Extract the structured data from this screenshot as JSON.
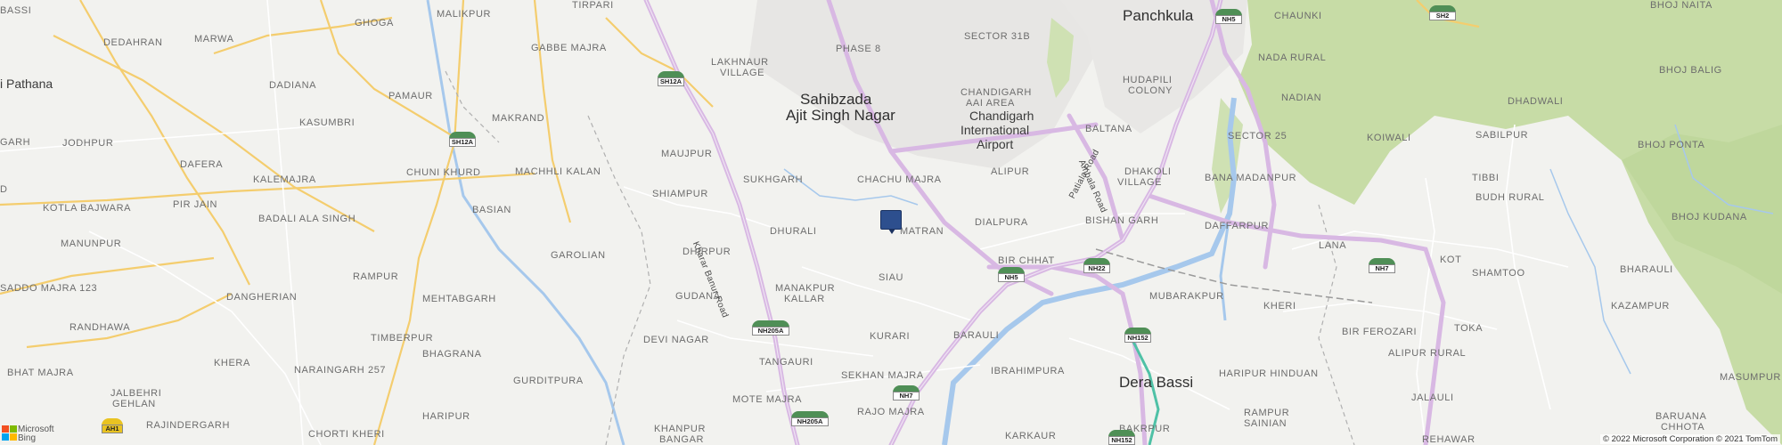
{
  "map": {
    "places": {
      "panchkula": "Panchkula",
      "sahibzada": "Sahibzada\nAjit Singh Nagar",
      "sahibzada_1": "Sahibzada",
      "sahibzada_2": "Ajit Singh Nagar",
      "dera_bassi": "Dera Bassi",
      "chandigarh_airport_1": "Chandigarh",
      "chandigarh_airport_2": "International",
      "chandigarh_airport_3": "Airport",
      "pathana": "i Pathana",
      "basi": "BASSI",
      "ghoga": "GHOGA",
      "malikpur": "MALIKPUR",
      "tirpari": "TIRPARI",
      "dedahran": "DEDAHRAN",
      "marwa": "MARWA",
      "gabbe_majra": "GABBE MAJRA",
      "lakhnaur_1": "LAKHNAUR",
      "lakhnaur_2": "VILLAGE",
      "phase8": "PHASE 8",
      "sector31b": "SECTOR 31B",
      "chaunki": "CHAUNKI",
      "bhoj_naita": "BHOJ NAITA",
      "nada_rural": "NADA RURAL",
      "hudapili_1": "HUDAPILI",
      "hudapili_2": "COLONY",
      "chandigarh_aai_1": "CHANDIGARH",
      "chandigarh_aai_2": "AAI AREA",
      "bhoj_balig": "BHOJ BALIG",
      "dadiana": "DADIANA",
      "pamaur": "PAMAUR",
      "nadian": "NADIAN",
      "dhadwali": "DHADWALI",
      "garh": "GARH",
      "kasumbri": "KASUMBRI",
      "makrand": "MAKRAND",
      "baltana": "BALTANA",
      "sector25": "SECTOR 25",
      "sabilpur": "SABILPUR",
      "koiwali": "KOIWALI",
      "bhoj_ponta": "BHOJ PONTA",
      "jodhpur": "JODHPUR",
      "maujpur": "MAUJPUR",
      "alipur": "ALIPUR",
      "dhakoli_1": "DHAKOLI",
      "dhakoli_2": "VILLAGE",
      "bana_madanpur": "BANA MADANPUR",
      "tibbi": "TIBBI",
      "dafera": "DAFERA",
      "chuni_khurd": "CHUNI KHURD",
      "machhli_kalan": "MACHHLI KALAN",
      "sukhgarh": "SUKHGARH",
      "chachu_majra": "CHACHU MAJRA",
      "kalemajra": "KALEMAJRA",
      "d": "D",
      "shiampur": "SHIAMPUR",
      "dialpura": "DIALPURA",
      "bishan_garh": "BISHAN GARH",
      "budh_rural": "BUDH RURAL",
      "kotla_bajwara": "KOTLA BAJWARA",
      "pir_jain": "PIR JAIN",
      "basian": "BASIAN",
      "daffarpur": "DAFFARPUR",
      "bhoj_kudana": "BHOJ KUDANA",
      "badali_ala_singh": "BADALI ALA SINGH",
      "dhurali": "DHURALI",
      "matran": "MATRAN",
      "lana": "LANA",
      "manunpur": "MANUNPUR",
      "dhirpur": "DHIRPUR",
      "garolian": "GAROLIAN",
      "bir_chhat": "BIR CHHAT",
      "kot": "KOT",
      "rampur": "RAMPUR",
      "siau": "SIAU",
      "shamtoo": "SHAMTOO",
      "bharauli": "BHARAULI",
      "saddo_majra": "SADDO MAJRA 123",
      "dangherian": "DANGHERIAN",
      "mehtabgarh": "MEHTABGARH",
      "manakpur_1": "MANAKPUR",
      "manakpur_2": "KALLAR",
      "gudana": "GUDANA",
      "mubarakpur": "MUBARAKPUR",
      "kheri": "KHERI",
      "kazampur": "KAZAMPUR",
      "randhawa": "RANDHAWA",
      "devi_nagar": "DEVI NAGAR",
      "kurari": "KURARI",
      "barauli": "BARAULI",
      "toka": "TOKA",
      "bir_ferozari": "BIR FEROZARI",
      "timberpur": "TIMBERPUR",
      "bhagrana": "BHAGRANA",
      "alipur_rural": "ALIPUR RURAL",
      "khera": "KHERA",
      "tangauri": "TANGAURI",
      "ibrahimpura": "IBRAHIMPURA",
      "haripur_hinduan": "HARIPUR HINDUAN",
      "bhat_majra": "BHAT MAJRA",
      "naraingarh": "NARAINGARH 257",
      "gurditpura": "GURDITPURA",
      "sekhan_majra": "SEKHAN MAJRA",
      "masumpur": "MASUMPUR",
      "jalbehri_1": "JALBEHRI",
      "jalbehri_2": "GEHLAN",
      "haripur": "HARIPUR",
      "mote_majra": "MOTE MAJRA",
      "rajo_majra": "RAJO MAJRA",
      "rampur_sainian_1": "RAMPUR",
      "rampur_sainian_2": "SAINIAN",
      "jalauli": "JALAULI",
      "baruana_1": "BARUANA",
      "baruana_2": "CHHOTA",
      "rajindergarh": "RAJINDERGARH",
      "chorti_kheri": "CHORTI KHERI",
      "khanpur_1": "KHANPUR",
      "khanpur_2": "BANGAR",
      "karkaur": "KARKAUR",
      "bakrpur": "BAKRPUR",
      "rehawar": "REHAWAR"
    },
    "roads": {
      "kharar_banur": "Kharar Banur Road",
      "patiala": "Patiala Road",
      "ambala": "Ambala Road"
    },
    "shields": {
      "sh12a_1": "SH12A",
      "sh12a_2": "SH12A",
      "nh5_top": "NH5",
      "sh2": "SH2",
      "nh5": "NH5",
      "nh22": "NH22",
      "nh7_east": "NH7",
      "nh205a_1": "NH205A",
      "nh152": "NH152",
      "nh7": "NH7",
      "nh205a_2": "NH205A",
      "nh152_b": "NH152",
      "ah1": "AH1"
    },
    "branding": {
      "logo_line1": "Microsoft",
      "logo_line2": "Bing",
      "copyright": "© 2022 Microsoft Corporation © 2021 TomTom"
    },
    "colors": {
      "background": "#f2f2ef",
      "forest": "#c7dca6",
      "water": "#a6c8ec",
      "major_road": "#d8b8e3",
      "state_road": "#f4cd6e",
      "pin": "#2d4f8e"
    }
  }
}
